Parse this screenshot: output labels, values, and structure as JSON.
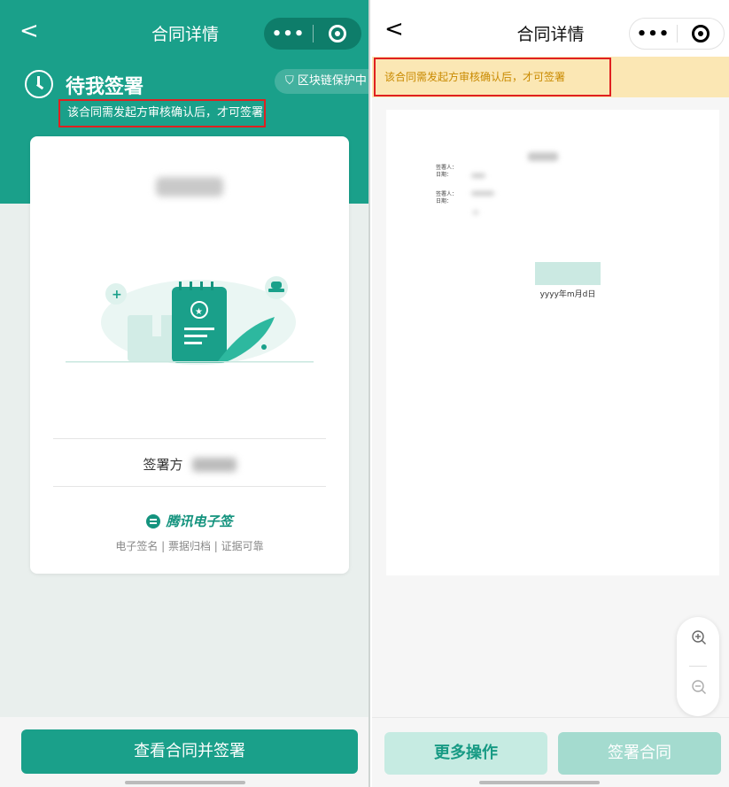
{
  "left": {
    "nav": {
      "back_glyph": "<",
      "title": "合同详情",
      "more_glyph": "•••"
    },
    "status": {
      "title": "待我签署",
      "notice": "该合同需发起方审核确认后，才可签署",
      "chain_badge": "区块链保护中"
    },
    "card": {
      "signer_label": "签署方",
      "brand_name": "腾讯电子签",
      "brand_slogan": "电子签名 | 票据归档 | 证据可靠"
    },
    "primary_button": "查看合同并签署",
    "colors": {
      "brand": "#1aa08a",
      "notice_border": "#e02020"
    }
  },
  "right": {
    "nav": {
      "back_glyph": "<",
      "title": "合同详情",
      "more_glyph": "•••"
    },
    "notice": "该合同需发起方审核确认后，才可签署",
    "document": {
      "signer_a_label": "签署人：",
      "date_a_label": "日期：",
      "signer_b_label": "签署人：",
      "date_b_label": "日期：",
      "date_format": "yyyy年m月d日"
    },
    "zoom": {
      "zoom_in_icon": "zoom-in-icon",
      "zoom_out_icon": "zoom-out-icon"
    },
    "buttons": {
      "more_actions": "更多操作",
      "sign": "签署合同"
    },
    "colors": {
      "notice_bg": "#fbe7b4",
      "notice_text": "#c98a00"
    }
  }
}
